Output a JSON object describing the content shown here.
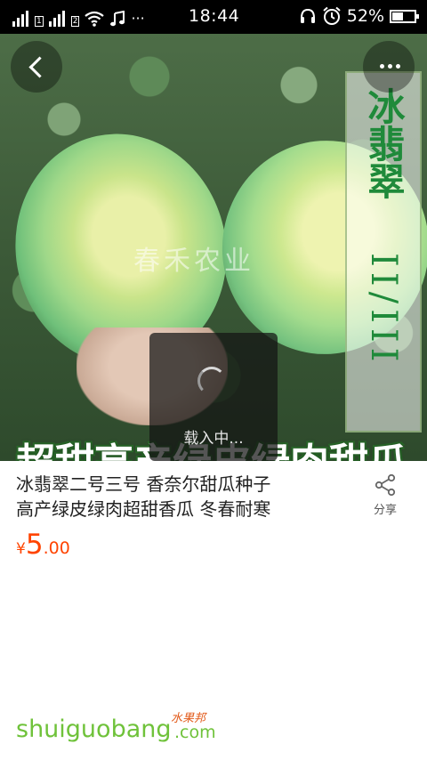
{
  "status_bar": {
    "time": "18:44",
    "battery_percent": "52%",
    "battery_level": 0.52,
    "icons": [
      "signal-icon",
      "signal-icon",
      "wifi-icon",
      "music-icon",
      "more-dots-icon",
      "headphones-icon",
      "alarm-icon",
      "battery-icon"
    ],
    "overflow": "···"
  },
  "image": {
    "watermark": "春禾农业",
    "vertical_title": "冰翡翠",
    "vertical_subtitle": "II/III",
    "banner": "超甜高产绿皮绿肉甜瓜"
  },
  "loading": {
    "text": "载入中..."
  },
  "product": {
    "title_line1": "冰翡翠二号三号 香奈尔甜瓜种子",
    "title_line2": "高产绿皮绿肉超甜香瓜  冬春耐寒",
    "price_currency": "¥",
    "price_integer": "5",
    "price_decimal": ".00"
  },
  "share": {
    "label": "分享",
    "icon": "share-icon"
  },
  "nav": {
    "back_icon": "back-chevron-icon",
    "more_icon": "more-dots-icon"
  },
  "footer": {
    "logo_main": "shuiguobang",
    "logo_cn": "水果邦",
    "logo_com": ".com",
    "brand_color": "#6fc23a"
  },
  "colors": {
    "price": "#ff4400",
    "text": "#222222"
  }
}
